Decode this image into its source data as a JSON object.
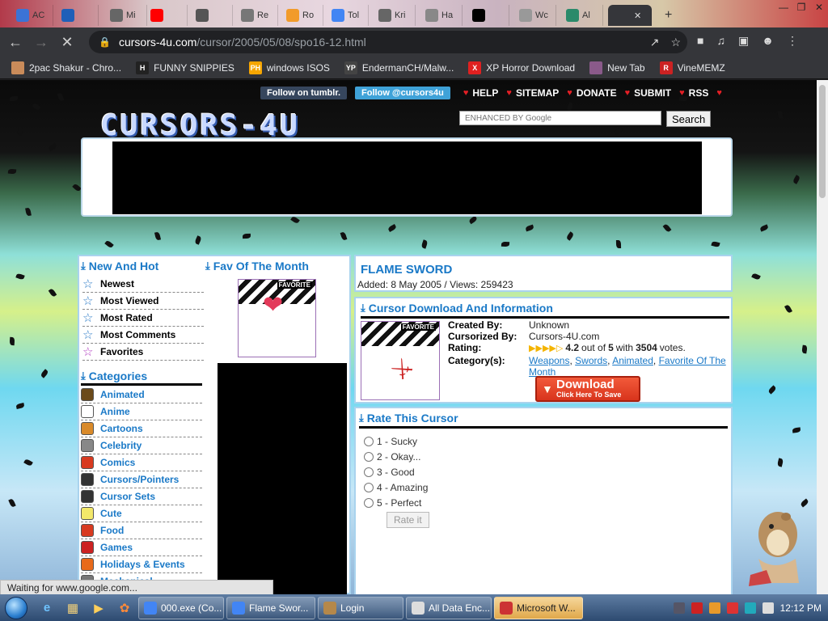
{
  "browser": {
    "tabs": [
      {
        "title": "AC",
        "color": "#3b73d6"
      },
      {
        "title": "",
        "color": "#1f5fb8"
      },
      {
        "title": "Mi",
        "color": "#666666"
      },
      {
        "title": "",
        "color": "#ff0000"
      },
      {
        "title": "",
        "color": "#555555"
      },
      {
        "title": "Re",
        "color": "#777777"
      },
      {
        "title": "Ro",
        "color": "#f29b2a"
      },
      {
        "title": "Tol",
        "color": "#4285f4"
      },
      {
        "title": "Kri",
        "color": "#666666"
      },
      {
        "title": "Ha",
        "color": "#888888"
      },
      {
        "title": "",
        "color": "#000000"
      },
      {
        "title": "Wc",
        "color": "#999999"
      },
      {
        "title": "Al",
        "color": "#2a8a6a"
      },
      {
        "title": "",
        "color": "#cc2222"
      }
    ],
    "url_host": "cursors-4u.com",
    "url_path": "/cursor/2005/05/08/spo16-12.html",
    "bookmarks": [
      {
        "label": "2pac Shakur - Chro...",
        "icon_text": "",
        "color": "#c98b5a"
      },
      {
        "label": "FUNNY SNIPPIES",
        "icon_text": "H",
        "color": "#222222"
      },
      {
        "label": "windows ISOS",
        "icon_text": "PH",
        "color": "#f7a600"
      },
      {
        "label": "EndermanCH/Malw...",
        "icon_text": "YP",
        "color": "#444444"
      },
      {
        "label": "XP Horror Download",
        "icon_text": "X",
        "color": "#e02020"
      },
      {
        "label": "New Tab",
        "icon_text": "",
        "color": "#8a5a8a"
      },
      {
        "label": "VineMEMZ",
        "icon_text": "R",
        "color": "#cc2222"
      }
    ]
  },
  "site": {
    "logo_text": "CURSORS-4U",
    "tumblr_label": "Follow on tumblr.",
    "twitter_label": "Follow @cursors4u",
    "nav": [
      "HELP",
      "SITEMAP",
      "DONATE",
      "SUBMIT",
      "RSS"
    ],
    "search_placeholder": "ENHANCED BY Google",
    "search_button": "Search"
  },
  "sidebar": {
    "new_and_hot_heading": "New And Hot",
    "fav_month_heading": "Fav Of The Month",
    "fav_tag": "FAVORITE",
    "menu": [
      "Newest",
      "Most Viewed",
      "Most Rated",
      "Most Comments",
      "Favorites"
    ],
    "categories_heading": "Categories",
    "categories": [
      {
        "label": "Animated",
        "color": "#6b4a1a"
      },
      {
        "label": "Anime",
        "color": "#ffffff"
      },
      {
        "label": "Cartoons",
        "color": "#d98a2a"
      },
      {
        "label": "Celebrity",
        "color": "#888888"
      },
      {
        "label": "Comics",
        "color": "#d83a20"
      },
      {
        "label": "Cursors/Pointers",
        "color": "#333333"
      },
      {
        "label": "Cursor Sets",
        "color": "#333333"
      },
      {
        "label": "Cute",
        "color": "#f3e86a"
      },
      {
        "label": "Food",
        "color": "#d83a20"
      },
      {
        "label": "Games",
        "color": "#cc2222"
      },
      {
        "label": "Holidays & Events",
        "color": "#e86a1a"
      },
      {
        "label": "Mechanical",
        "color": "#777777"
      }
    ]
  },
  "cursor": {
    "title": "FLAME SWORD",
    "added_line": "Added: 8 May 2005 / Views: 259423",
    "info_heading": "Cursor Download And Information",
    "image_tag": "FAVORITE",
    "created_by_label": "Created By:",
    "created_by": "Unknown",
    "cursorized_by_label": "Cursorized By:",
    "cursorized_by": "Cursors-4U.com",
    "rating_label": "Rating:",
    "rating_value": "4.2",
    "rating_out_of": "out of",
    "rating_max": "5",
    "rating_with": "with",
    "rating_votes": "3504",
    "rating_votes_word": "votes.",
    "rating_stars": 4.2,
    "category_label": "Category(s):",
    "categories": [
      "Weapons",
      "Swords",
      "Animated",
      "Favorite Of The Month"
    ],
    "download_big": "Download",
    "download_small": "Click Here To Save"
  },
  "rate": {
    "heading": "Rate This Cursor",
    "options": [
      "1 - Sucky",
      "2 - Okay...",
      "3 - Good",
      "4 - Amazing",
      "5 - Perfect"
    ],
    "button": "Rate it"
  },
  "status_text": "Waiting for www.google.com...",
  "taskbar": {
    "buttons": [
      {
        "label": "000.exe (Co...",
        "color": "#4285f4",
        "active": false
      },
      {
        "label": "Flame Swor...",
        "color": "#4285f4",
        "active": false
      },
      {
        "label": "Login",
        "color": "#b5884a",
        "active": false
      },
      {
        "label": "All Data Enc...",
        "color": "#dddddd",
        "active": false
      },
      {
        "label": "Microsoft W...",
        "color": "#cc3333",
        "active": true
      }
    ],
    "clock": "12:12 PM"
  }
}
